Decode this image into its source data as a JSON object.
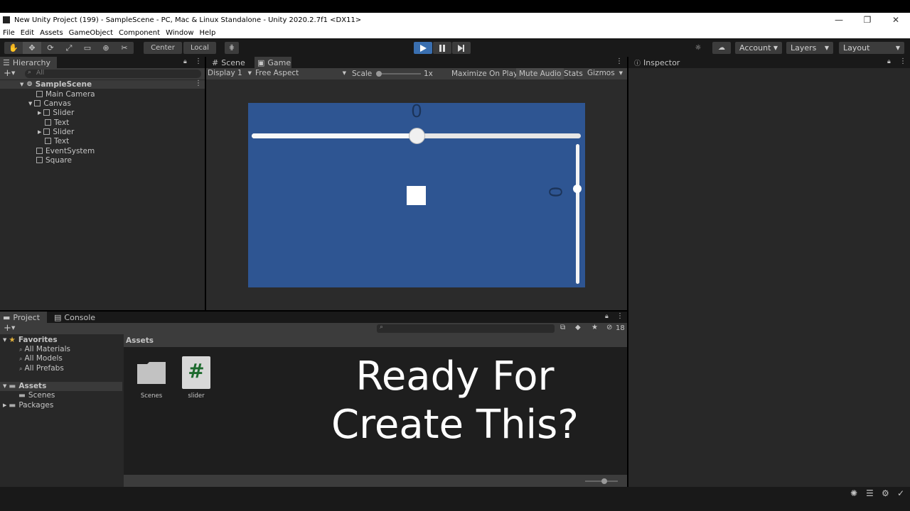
{
  "window": {
    "title": "New Unity Project (199) - SampleScene - PC, Mac & Linux Standalone - Unity 2020.2.7f1 <DX11>",
    "controls": [
      "—",
      "❐",
      "✕"
    ]
  },
  "menu": [
    "File",
    "Edit",
    "Assets",
    "GameObject",
    "Component",
    "Window",
    "Help"
  ],
  "toolbar": {
    "pivot_center": "Center",
    "pivot_local": "Local",
    "account": "Account",
    "layers": "Layers",
    "layout": "Layout"
  },
  "hierarchy": {
    "tab": "Hierarchy",
    "search_placeholder": "All",
    "items": [
      {
        "label": "SampleScene"
      },
      {
        "label": "Main Camera"
      },
      {
        "label": "Canvas"
      },
      {
        "label": "Slider"
      },
      {
        "label": "Text"
      },
      {
        "label": "Slider"
      },
      {
        "label": "Text"
      },
      {
        "label": "EventSystem"
      },
      {
        "label": "Square"
      }
    ]
  },
  "scene_tabs": {
    "scene": "Scene",
    "game": "Game"
  },
  "game_toolbar": {
    "display": "Display 1",
    "aspect": "Free Aspect",
    "scale_label": "Scale",
    "scale_value": "1x",
    "maximize": "Maximize On Play",
    "mute": "Mute Audio",
    "stats": "Stats",
    "gizmos": "Gizmos"
  },
  "game": {
    "horizontal_value_text": "0",
    "vertical_value_text": "0",
    "horizontal_slider_value": 0.5,
    "vertical_slider_value": 0.68,
    "colors": {
      "background": "#2e5592",
      "square": "#ffffff"
    }
  },
  "inspector": {
    "tab": "Inspector"
  },
  "project": {
    "tab_project": "Project",
    "tab_console": "Console",
    "hidden_count": "18",
    "favorites_label": "Favorites",
    "favorites": [
      "All Materials",
      "All Models",
      "All Prefabs"
    ],
    "assets_label": "Assets",
    "assets_children": [
      "Scenes"
    ],
    "packages_label": "Packages",
    "breadcrumb": "Assets",
    "files": [
      {
        "name": "Scenes",
        "icon": "folder-icon"
      },
      {
        "name": "slider",
        "icon": "csharp-script-icon"
      }
    ]
  },
  "overlay": {
    "line1": "Ready For",
    "line2": "Create This?"
  }
}
